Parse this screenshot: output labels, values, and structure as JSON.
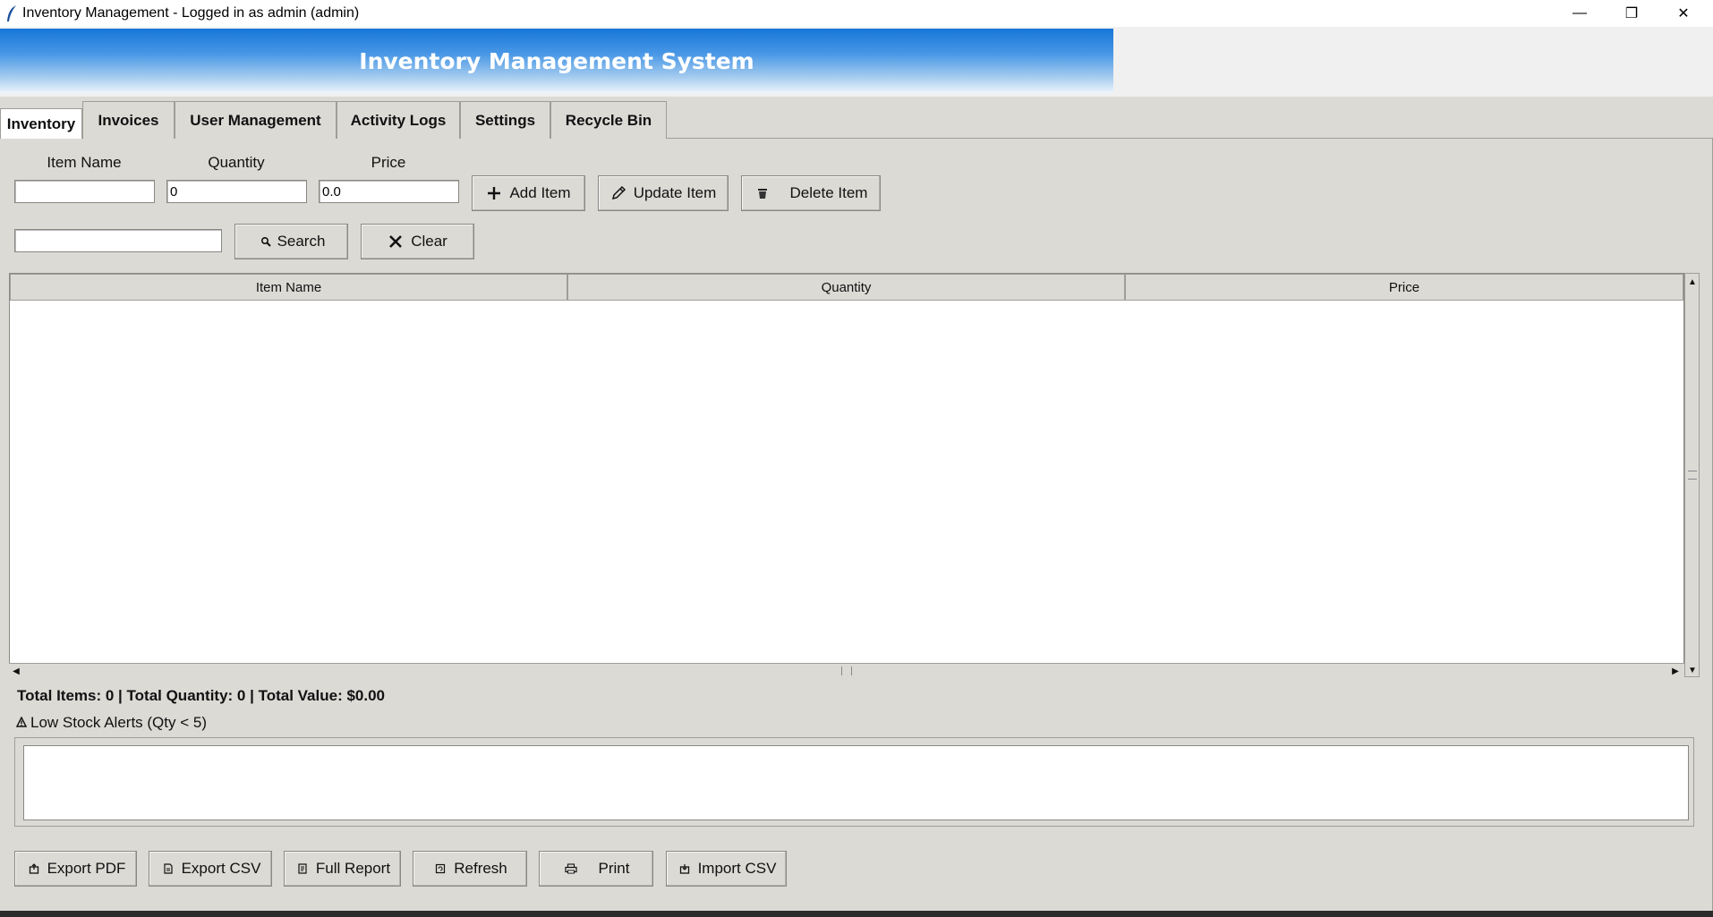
{
  "window": {
    "title": "Inventory Management - Logged in as admin (admin)",
    "minimize_glyph": "—",
    "maximize_glyph": "❐",
    "close_glyph": "✕"
  },
  "banner": {
    "title": "Inventory Management System"
  },
  "tabs": [
    {
      "label": "Inventory",
      "active": true
    },
    {
      "label": "Invoices",
      "active": false
    },
    {
      "label": "User Management",
      "active": false
    },
    {
      "label": "Activity Logs",
      "active": false
    },
    {
      "label": "Settings",
      "active": false
    },
    {
      "label": "Recycle Bin",
      "active": false
    }
  ],
  "form": {
    "item_name_label": "Item Name",
    "quantity_label": "Quantity",
    "price_label": "Price",
    "item_name_value": "",
    "quantity_value": "0",
    "price_value": "0.0",
    "add_label": "Add Item",
    "update_label": "Update Item",
    "delete_label": "Delete Item"
  },
  "search": {
    "value": "",
    "search_label": "Search",
    "clear_label": "Clear"
  },
  "table": {
    "columns": [
      "Item Name",
      "Quantity",
      "Price"
    ],
    "rows": []
  },
  "summary": {
    "text": "Total Items: 0 | Total Quantity: 0 | Total Value: $0.00"
  },
  "alerts": {
    "label": "Low Stock Alerts (Qty < 5)",
    "content": ""
  },
  "actions": {
    "export_pdf": "Export PDF",
    "export_csv": "Export CSV",
    "full_report": "Full Report",
    "refresh": "Refresh",
    "print": "Print",
    "import_csv": "Import CSV"
  },
  "colors": {
    "accent_blue": "#1676d8",
    "panel_bg": "#dcdad5"
  }
}
